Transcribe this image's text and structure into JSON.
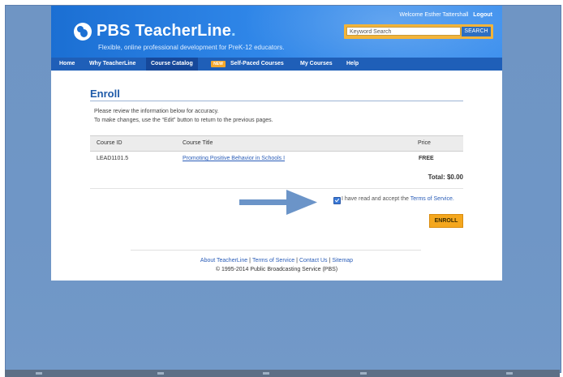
{
  "header": {
    "brand": "PBS TeacherLine",
    "brand_dot": ".",
    "tagline": "Flexible, online professional development for PreK-12 educators.",
    "welcome": "Welcome Esther Tattershall",
    "logout": "Logout",
    "search_placeholder": "Keyword Search",
    "search_button": "SEARCH"
  },
  "nav": {
    "items": [
      "Home",
      "Why TeacherLine",
      "Course Catalog",
      "Self-Paced Courses",
      "My Courses",
      "Help"
    ],
    "new_badge": "NEW",
    "active": "Course Catalog"
  },
  "main": {
    "title": "Enroll",
    "intro_line1": "Please review the information below for accuracy.",
    "intro_line2": "To make changes, use the “Edit” button to return to the previous pages.",
    "table": {
      "headers": [
        "Course ID",
        "Course Title",
        "Price"
      ],
      "rows": [
        {
          "id": "LEAD1101.5",
          "title": "Promoting Positive Behavior in Schools I",
          "price": "FREE"
        }
      ]
    },
    "total": "Total: $0.00",
    "accept_text": "I have read and accept the",
    "accept_link": "Terms of Service.",
    "enroll_button": "ENROLL"
  },
  "footer": {
    "links": [
      "About TeacherLine",
      "Terms of Service",
      "Contact Us",
      "Sitemap"
    ],
    "separator": "|",
    "copyright": "© 1995-2014 Public Broadcasting Service (PBS)"
  },
  "colors": {
    "header_blue": "#2f86e8",
    "nav_blue": "#1f5fb8",
    "title_blue": "#1e5aa8",
    "accent_orange": "#f4a71e",
    "desktop_blue": "#6f96c6",
    "annotation_arrow": "#6b94c8"
  },
  "icons": [
    "pbs-logo-icon",
    "arrow-right-icon",
    "checkbox-checked-icon"
  ]
}
